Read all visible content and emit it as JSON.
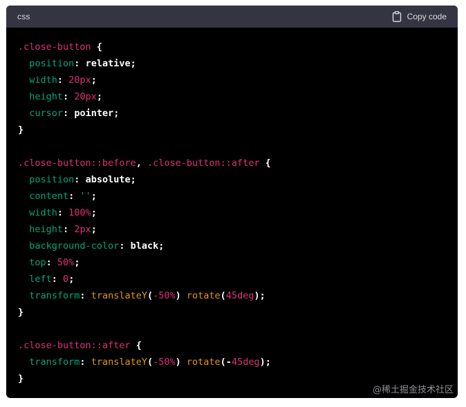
{
  "header": {
    "language": "css",
    "copy_label": "Copy code"
  },
  "code_lines": [
    [
      {
        "t": "sel",
        "v": ".close-button"
      },
      {
        "t": "punc",
        "v": " {"
      }
    ],
    [
      {
        "t": "plain",
        "v": "  "
      },
      {
        "t": "prop",
        "v": "position"
      },
      {
        "t": "punc",
        "v": ": "
      },
      {
        "t": "val",
        "v": "relative"
      },
      {
        "t": "punc",
        "v": ";"
      }
    ],
    [
      {
        "t": "plain",
        "v": "  "
      },
      {
        "t": "prop",
        "v": "width"
      },
      {
        "t": "punc",
        "v": ": "
      },
      {
        "t": "num",
        "v": "20px"
      },
      {
        "t": "punc",
        "v": ";"
      }
    ],
    [
      {
        "t": "plain",
        "v": "  "
      },
      {
        "t": "prop",
        "v": "height"
      },
      {
        "t": "punc",
        "v": ": "
      },
      {
        "t": "num",
        "v": "20px"
      },
      {
        "t": "punc",
        "v": ";"
      }
    ],
    [
      {
        "t": "plain",
        "v": "  "
      },
      {
        "t": "prop",
        "v": "cursor"
      },
      {
        "t": "punc",
        "v": ": "
      },
      {
        "t": "val",
        "v": "pointer"
      },
      {
        "t": "punc",
        "v": ";"
      }
    ],
    [
      {
        "t": "punc",
        "v": "}"
      }
    ],
    [],
    [
      {
        "t": "sel",
        "v": ".close-button::before"
      },
      {
        "t": "punc",
        "v": ", "
      },
      {
        "t": "sel",
        "v": ".close-button::after"
      },
      {
        "t": "punc",
        "v": " {"
      }
    ],
    [
      {
        "t": "plain",
        "v": "  "
      },
      {
        "t": "prop",
        "v": "position"
      },
      {
        "t": "punc",
        "v": ": "
      },
      {
        "t": "val",
        "v": "absolute"
      },
      {
        "t": "punc",
        "v": ";"
      }
    ],
    [
      {
        "t": "plain",
        "v": "  "
      },
      {
        "t": "prop",
        "v": "content"
      },
      {
        "t": "punc",
        "v": ": "
      },
      {
        "t": "str",
        "v": "''"
      },
      {
        "t": "punc",
        "v": ";"
      }
    ],
    [
      {
        "t": "plain",
        "v": "  "
      },
      {
        "t": "prop",
        "v": "width"
      },
      {
        "t": "punc",
        "v": ": "
      },
      {
        "t": "num",
        "v": "100%"
      },
      {
        "t": "punc",
        "v": ";"
      }
    ],
    [
      {
        "t": "plain",
        "v": "  "
      },
      {
        "t": "prop",
        "v": "height"
      },
      {
        "t": "punc",
        "v": ": "
      },
      {
        "t": "num",
        "v": "2px"
      },
      {
        "t": "punc",
        "v": ";"
      }
    ],
    [
      {
        "t": "plain",
        "v": "  "
      },
      {
        "t": "prop",
        "v": "background-color"
      },
      {
        "t": "punc",
        "v": ": "
      },
      {
        "t": "val",
        "v": "black"
      },
      {
        "t": "punc",
        "v": ";"
      }
    ],
    [
      {
        "t": "plain",
        "v": "  "
      },
      {
        "t": "prop",
        "v": "top"
      },
      {
        "t": "punc",
        "v": ": "
      },
      {
        "t": "num",
        "v": "50%"
      },
      {
        "t": "punc",
        "v": ";"
      }
    ],
    [
      {
        "t": "plain",
        "v": "  "
      },
      {
        "t": "prop",
        "v": "left"
      },
      {
        "t": "punc",
        "v": ": "
      },
      {
        "t": "num",
        "v": "0"
      },
      {
        "t": "punc",
        "v": ";"
      }
    ],
    [
      {
        "t": "plain",
        "v": "  "
      },
      {
        "t": "prop",
        "v": "transform"
      },
      {
        "t": "punc",
        "v": ": "
      },
      {
        "t": "fn",
        "v": "translateY"
      },
      {
        "t": "punc",
        "v": "("
      },
      {
        "t": "num",
        "v": "-50%"
      },
      {
        "t": "punc",
        "v": ") "
      },
      {
        "t": "fn",
        "v": "rotate"
      },
      {
        "t": "punc",
        "v": "("
      },
      {
        "t": "num",
        "v": "45deg"
      },
      {
        "t": "punc",
        "v": ");"
      }
    ],
    [
      {
        "t": "punc",
        "v": "}"
      }
    ],
    [],
    [
      {
        "t": "sel",
        "v": ".close-button::after"
      },
      {
        "t": "punc",
        "v": " {"
      }
    ],
    [
      {
        "t": "plain",
        "v": "  "
      },
      {
        "t": "prop",
        "v": "transform"
      },
      {
        "t": "punc",
        "v": ": "
      },
      {
        "t": "fn",
        "v": "translateY"
      },
      {
        "t": "punc",
        "v": "("
      },
      {
        "t": "num",
        "v": "-50%"
      },
      {
        "t": "punc",
        "v": ") "
      },
      {
        "t": "fn",
        "v": "rotate"
      },
      {
        "t": "punc",
        "v": "(-"
      },
      {
        "t": "num",
        "v": "45deg"
      },
      {
        "t": "punc",
        "v": ");"
      }
    ],
    [
      {
        "t": "punc",
        "v": "}"
      }
    ]
  ],
  "watermark": "@稀土掘金技术社区",
  "icons": {
    "copy": "clipboard-icon"
  },
  "colors": {
    "header_bg": "#343541",
    "code_bg": "#000000",
    "selector": "#df3079",
    "property": "#00a67d",
    "function": "#e9950c"
  }
}
